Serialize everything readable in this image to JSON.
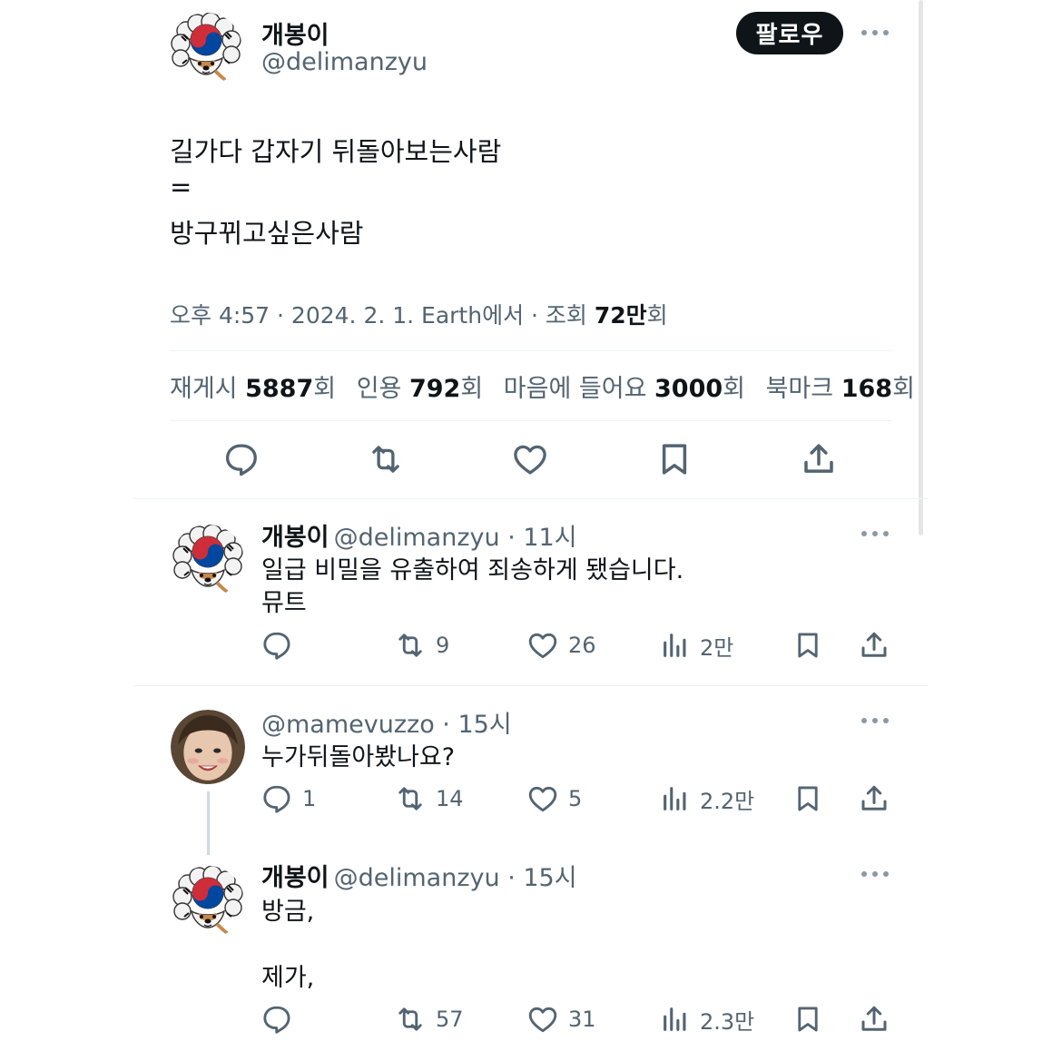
{
  "main_tweet": {
    "author_name": "개봉이",
    "author_handle": "@delimanzyu",
    "follow_label": "팔로우",
    "text_line1": "길가다 갑자기 뒤돌아보는사람",
    "text_line2": "=",
    "text_line3": "방구뀌고싶은사람",
    "meta_prefix": "오후 4:57 · 2024. 2. 1. Earth에서 · 조회 ",
    "views": "72만",
    "views_suffix": "회",
    "stats": {
      "reposts_label": "재게시 ",
      "reposts": "5887",
      "quotes_label": "인용 ",
      "quotes": "792",
      "likes_label": "마음에 들어요 ",
      "likes": "3000",
      "bookmarks_label": "북마크 ",
      "bookmarks": "168",
      "unit": "회"
    }
  },
  "replies": [
    {
      "author_name": "개봉이",
      "author_handle": "@delimanzyu",
      "time": "11시",
      "line1": "일급 비밀을 유출하여 죄송하게 됐습니다.",
      "line2": "뮤트",
      "replies": "",
      "reposts": "9",
      "likes": "26",
      "views": "2만"
    },
    {
      "author_name": "",
      "author_handle": "@mamevuzzo",
      "time": "15시",
      "line1": "누가뒤돌아봤나요?",
      "line2": "",
      "replies": "1",
      "reposts": "14",
      "likes": "5",
      "views": "2.2만"
    },
    {
      "author_name": "개봉이",
      "author_handle": "@delimanzyu",
      "time": "15시",
      "line1": "방금,",
      "line2": "제가,",
      "replies": "",
      "reposts": "57",
      "likes": "31",
      "views": "2.3만"
    }
  ],
  "separator": " · ",
  "icons": {
    "reply": "reply-icon",
    "repost": "repost-icon",
    "like": "heart-icon",
    "views": "views-chart-icon",
    "bookmark": "bookmark-icon",
    "share": "share-icon",
    "more": "more-icon"
  },
  "colors": {
    "text": "#0f1419",
    "muted": "#536471",
    "divider": "#eff3f4",
    "flag_red": "#cd2e3a",
    "flag_blue": "#0047a0"
  }
}
